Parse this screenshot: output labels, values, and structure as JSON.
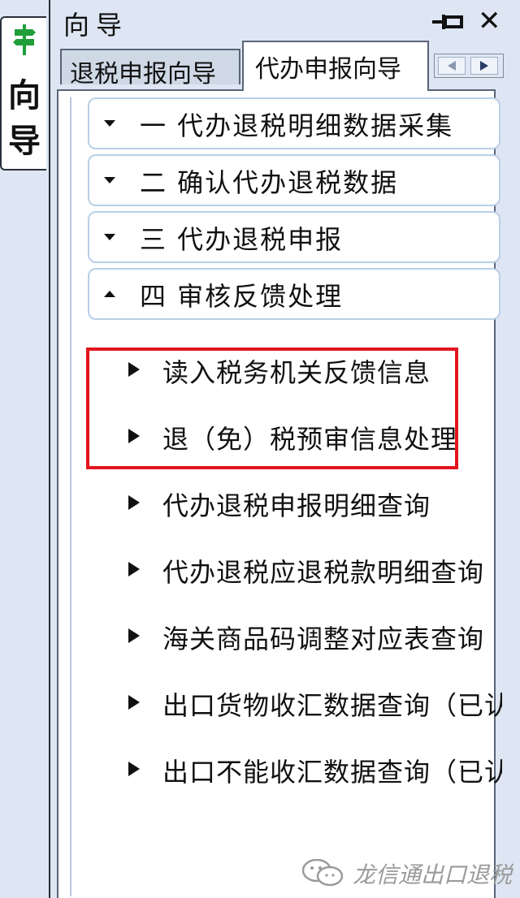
{
  "side_tab": {
    "label": "向导",
    "icon": "signpost-icon",
    "icon_color": "#1f9e3a"
  },
  "panel": {
    "title": "向导",
    "pin_icon": "pin-icon",
    "close_glyph": "✕"
  },
  "tabs": [
    {
      "label": "退税申报向导",
      "selected": false
    },
    {
      "label": "代办申报向导",
      "selected": true
    }
  ],
  "sections": [
    {
      "label": "一 代办退税明细数据采集",
      "expanded": false
    },
    {
      "label": "二 确认代办退税数据",
      "expanded": false
    },
    {
      "label": "三 代办退税申报",
      "expanded": false
    },
    {
      "label": "四 审核反馈处理",
      "expanded": true
    }
  ],
  "items": [
    {
      "label": "读入税务机关反馈信息",
      "highlighted": true
    },
    {
      "label": "退（免）税预审信息处理",
      "highlighted": true
    },
    {
      "label": "代办退税申报明细查询",
      "highlighted": false
    },
    {
      "label": "代办退税应退税款明细查询",
      "highlighted": false
    },
    {
      "label": "海关商品码调整对应表查询",
      "highlighted": false
    },
    {
      "label": "出口货物收汇数据查询（已认",
      "highlighted": false
    },
    {
      "label": "出口不能收汇数据查询（已认",
      "highlighted": false
    }
  ],
  "highlight_color": "#e2151f",
  "watermark": {
    "text": "龙信通出口退税",
    "icon": "wechat-icon"
  }
}
